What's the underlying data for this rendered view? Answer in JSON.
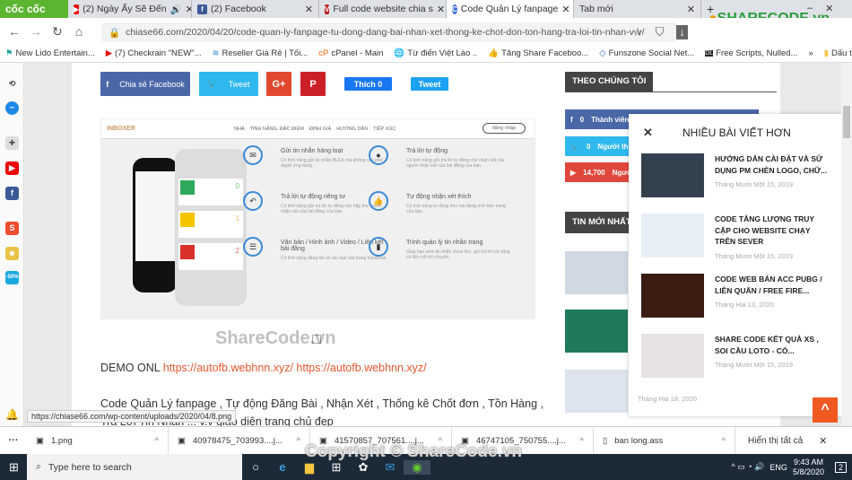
{
  "browser": {
    "logo": "cốc cốc",
    "tabs": [
      {
        "label": "(2) Ngày Ấy Sẽ Đến",
        "icon": "youtube-icon"
      },
      {
        "label": "(2) Facebook",
        "icon": "facebook-icon"
      },
      {
        "label": "Full code website chia s",
        "icon": "site-icon"
      },
      {
        "label": "Code Quản Lý fanpage",
        "icon": "coccoc-icon",
        "active": true
      },
      {
        "label": "Tab mới"
      }
    ],
    "url": "chiase66.com/2020/04/20/code-quan-ly-fanpage-tu-dong-dang-bai-nhan-xet-thong-ke-chot-don-ton-hang-tra-loi-tin-nhan-v-v/",
    "bookmarks": [
      "New Lido Entertain...",
      "(7) Checkrain \"NEW\"...",
      "Reseller Giá Rẻ | Tối...",
      "cPanel - Main",
      "Từ điển Việt Lào ..",
      "Tăng Share Faceboo...",
      "Funszone Social Net...",
      "Free Scripts, Nulled..."
    ],
    "bookmarks_more": "»",
    "bookmarks_folder": "Dấu trang khác",
    "sidebar_badge": "-50%"
  },
  "share": {
    "facebook": "Chia sẻ Facebook",
    "tweet": "Tweet",
    "gplus": "G+",
    "pinterest": "P",
    "like": "Thích 0",
    "tweet2": "Tweet"
  },
  "screenshot": {
    "brand": "INBOXER",
    "menu": [
      "NHÀ",
      "TÍNH NĂNG, ĐẶC ĐIỂM",
      "ĐỊNH GIÁ",
      "HƯỚNG DẪN",
      "TIẾP XÚC"
    ],
    "login": "đăng nhập",
    "stats": [
      "0",
      "1",
      "2"
    ],
    "features": [
      {
        "title": "Gửi tin nhắn hàng loạt",
        "desc": "Có tính năng gửi tin nhắn BULK mà không cần phê duyệt ứng dụng."
      },
      {
        "title": "Trả lời tự động",
        "desc": "Có tính năng gửi trả lời tự động cho nhận xét của người nhận xét của bài đăng của bạn."
      },
      {
        "title": "Trả lời tự động riêng tư",
        "desc": "Có tính năng gửi trả lời tự động vào hộp thư người nhận xét của bài đăng của bạn."
      },
      {
        "title": "Tự động nhận xét thích",
        "desc": "Có tính năng tự động như bài đăng mới trên trang của bạn."
      },
      {
        "title": "Văn bản / Hình ảnh / Video / Liên kết bài đăng",
        "desc": "Có tính năng đăng tất cả các loại vào trang facebook."
      },
      {
        "title": "Trình quản lý tin nhắn trang",
        "desc": "Giúp bạn xem tin nhắn chưa đọc, gửi trả lời và cũng có tiện ích trò chuyện"
      }
    ]
  },
  "article": {
    "demo_label": "DEMO ONL",
    "demo_links": "https://autofb.webhnn.xyz/ https://autofb.webhnn.xyz/",
    "para": "Code Quản Lý fanpage , Tự động Đăng Bài , Nhận Xét , Thống kê Chốt đơn , Tồn Hàng ,",
    "para2": "Trả Lời Tin Nhắn ... v.v giao diện trang chủ đẹp"
  },
  "widgets": {
    "follow_title": "THEO CHÚNG TÔI",
    "social": [
      {
        "count": "0",
        "label": "Thành viên"
      },
      {
        "count": "0",
        "label": "Người theo dõi"
      },
      {
        "count": "14,700",
        "label": "Người đăng ký"
      }
    ],
    "latest_title": "TIN MỚI NHẤT",
    "latest_date": "Tháng Hai 18, 2020"
  },
  "popup": {
    "title": "NHIỀU BÀI VIẾT HƠN",
    "items": [
      {
        "title": "HƯỚNG DẪN CÀI ĐẶT VÀ SỬ DỤNG PM CHÈN LOGO, CHỮ...",
        "date": "Tháng Mười Một 15, 2019"
      },
      {
        "title": "CODE TĂNG LƯỢNG TRUY CẬP CHO WEBSITE CHẠY TRÊN SEVER",
        "date": "Tháng Mười Một 15, 2019"
      },
      {
        "title": "CODE WEB BÁN ACC PUBG / LIÊN QUÂN / FREE FIRE...",
        "date": "Tháng Hai 13, 2020"
      },
      {
        "title": "SHARE CODE KẾT QUẢ XS , SOI CẦU LOTO - CÓ...",
        "date": "Tháng Mười Một 15, 2019"
      }
    ]
  },
  "status_url": "https://chiase66.com/wp-content/uploads/2020/04/8.png",
  "downloads": {
    "items": [
      "1.png",
      "40978475_703993....j...",
      "41570857_707561....j...",
      "46747105_750755....j...",
      "ban long.ass"
    ],
    "show_all": "Hiển thị tất cả"
  },
  "taskbar": {
    "search": "Type here to search",
    "lang": "ENG",
    "time": "9:43 AM",
    "date": "5/8/2020",
    "notif": "2"
  },
  "watermark": {
    "logo": "SHARECODE.vn",
    "center": "ShareCode.vn",
    "copyright": "Copyright © ShareCode.vn"
  }
}
